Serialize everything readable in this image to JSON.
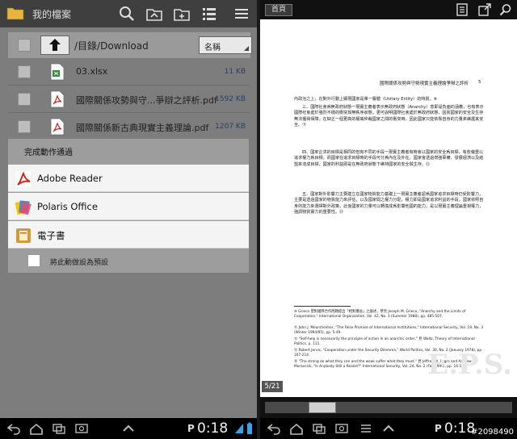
{
  "left_panel": {
    "title": "我的檔案",
    "path": "/目錄/Download",
    "sort_option": "名稱",
    "files": [
      {
        "name": "03.xlsx",
        "size": "11 KB",
        "type": "excel"
      },
      {
        "name": "國際關係攻勢與守...爭辯之評析.pdf",
        "size": "1592 KB",
        "type": "pdf"
      },
      {
        "name": "國際關係新古典現實主義理論.pdf",
        "size": "1207 KB",
        "type": "pdf"
      }
    ],
    "dialog": {
      "title": "完成動作通過",
      "apps": [
        {
          "label": "Adobe Reader",
          "icon": "adobe-reader-icon"
        },
        {
          "label": "Polaris Office",
          "icon": "polaris-office-icon"
        },
        {
          "label": "電子書",
          "icon": "ebook-icon"
        }
      ],
      "default_label": "將此動做設為預設"
    },
    "clock": "0:18"
  },
  "right_panel": {
    "home_label": "首頁",
    "page_header": "國際關係攻勢與守勢現實主義理論爭辯之評析",
    "page_number": "5",
    "paragraphs": [
      "內政治之上，在對外行動上顯現國家是單一實體（Unitary Entity）的特質。⑩",
      "三、國際社會爲無政府狀態一現實主義者表示無政府狀態（Anarchy）意即是負面的涵義，也有表示國際社會處於強烈不穩的衝突與無秩序狀態，更可說明國際社會處於無政府狀態，因而國家的安全及生存無法獲得保障，在缺乏一個更高的權威仲裁國家之間的衝突時，因此國家只能依靠自身的力量來維護其安全。⑪",
      "四、國家企求的目標是相同的但有不同的手段一現實主義者有時會以國家的安全爲目標，有些偏重以追求權力爲目標，而國家在追求目標時的手段可分爲內在及外在，國家會透過增強軍備、發展經濟以及結盟來達成目標，國家的利益即是在無政府狀態下維持國家的安全與生存。⑫",
      "五、國家對外影響力主要建立在國家物質能力基礎上一現實主義者認爲國家追求目標時仍受影響力，主要是透過國家的物質能力來評估，以及國家間之權力分配，權力即是國家追求利益的手段，國家依照自身的能力來選擇對外政策，此後國家的力量可以轉換成爲影響他國的能力，是以現實主義理論重視權力，強調物質實力的重要性。⑬"
    ],
    "footnotes": [
      "⑩ Grieco 曾對國際合作問題提出「相對獲益」之論述，參見 Joseph M. Grieco, \"Anarchy and the Limits of Cooperation,\" International Organization, Vol. 42, No. 3 (Summer 1988), pp. 485-507.",
      "⑪ John J. Mearsheimer, \"The False Promise of International Institutions,\" International Security, Vol. 19, No. 3 (Winter 1994/95), pp. 5-49.",
      "⑫ \"Self-help is necessarily the principle of action in an anarchic order,\" 見 Waltz, Theory of International Politics, p. 111.",
      "⑬ Robert Jervis, \"Cooperation under the Security Dilemma,\" World Politics, Vol. 30, No. 2 (January 1978), pp. 167-214.",
      "⑭ \"The strong do what they can and the weak suffer what they must.\" 見 Jeffrey W. Legro and Andrew Moravcsik, \"Is Anybody Still a Realist?\" International Security, Vol. 24, No. 2 (Fall 1999), pp. 16-18."
    ],
    "page_indicator": "5/21",
    "watermark": "E.P.S.",
    "clock": "0:18"
  },
  "credit": "#2098490"
}
